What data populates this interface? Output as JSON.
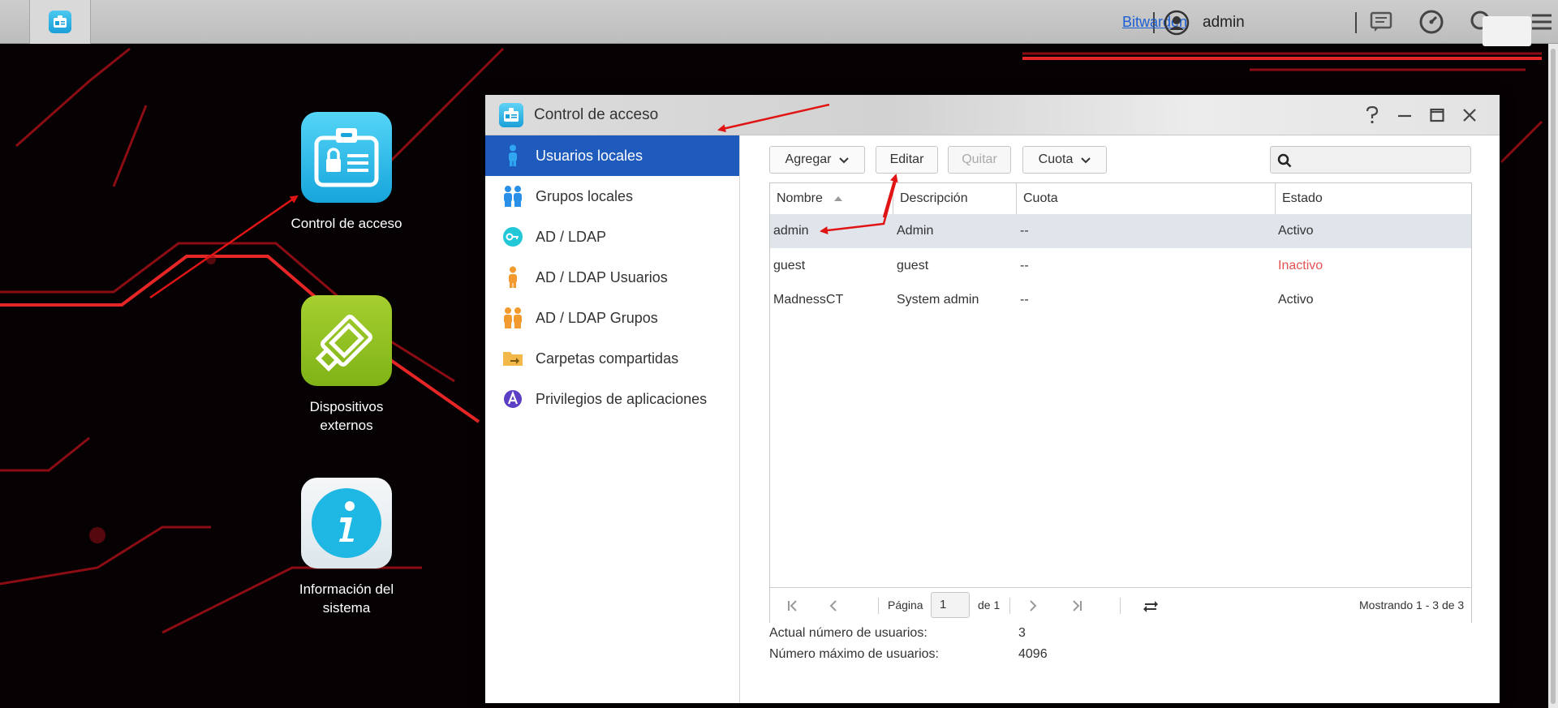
{
  "taskbar": {
    "link": "Bitwarden",
    "user": "admin"
  },
  "desktop": {
    "icons": [
      {
        "label": "Control de acceso"
      },
      {
        "label": "Dispositivos externos"
      },
      {
        "label": "Información del sistema"
      }
    ]
  },
  "window": {
    "title": "Control de acceso",
    "controls": [
      "help-icon",
      "minimize-icon",
      "maximize-icon",
      "close-icon"
    ]
  },
  "sidebar": {
    "items": [
      {
        "label": "Usuarios locales",
        "icon": "user-icon",
        "active": true
      },
      {
        "label": "Grupos locales",
        "icon": "group-icon"
      },
      {
        "label": "AD / LDAP",
        "icon": "key-icon"
      },
      {
        "label": "AD / LDAP Usuarios",
        "icon": "ldap-user-icon"
      },
      {
        "label": "AD / LDAP Grupos",
        "icon": "ldap-group-icon"
      },
      {
        "label": "Carpetas compartidas",
        "icon": "shared-folder-icon"
      },
      {
        "label": "Privilegios de aplicaciones",
        "icon": "app-privileges-icon"
      }
    ]
  },
  "toolbar": {
    "add_label": "Agregar",
    "edit_label": "Editar",
    "remove_label": "Quitar",
    "quota_label": "Cuota",
    "search_placeholder": ""
  },
  "table": {
    "columns": [
      "Nombre",
      "Descripción",
      "Cuota",
      "Estado"
    ],
    "rows": [
      {
        "name": "admin",
        "description": "Admin",
        "quota": "--",
        "status": "Activo"
      },
      {
        "name": "guest",
        "description": "guest",
        "quota": "--",
        "status": "Inactivo"
      },
      {
        "name": "MadnessCT",
        "description": "System admin",
        "quota": "--",
        "status": "Activo"
      }
    ]
  },
  "pager": {
    "page_label": "Página",
    "page_value": "1",
    "of_label": "de 1",
    "showing": "Mostrando 1 - 3 de 3"
  },
  "stats": {
    "current_label": "Actual número de usuarios:",
    "current_value": "3",
    "max_label": "Número máximo de usuarios:",
    "max_value": "4096"
  },
  "colors": {
    "accent": "#1e5bbd",
    "inactive": "#e45353",
    "annotation": "#e01414"
  }
}
